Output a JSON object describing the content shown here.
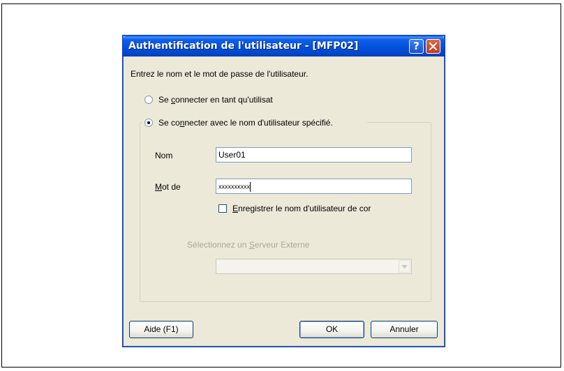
{
  "dialog": {
    "title": "Authentification de l'utilisateur - [MFP02]",
    "help_button": "?",
    "instruction": "Entrez le nom et le mot de passe de l'utilisateur."
  },
  "login_options": {
    "option_current_user_pre": "Se ",
    "option_current_user_key": "c",
    "option_current_user_post": "onnecter en tant qu'utilisat",
    "option_specified_user_pre": "Se co",
    "option_specified_user_key": "n",
    "option_specified_user_post": "necter avec le nom d'utilisateur spécifié.",
    "selected": "specified_user"
  },
  "credentials": {
    "name_label": "Nom",
    "name_value": "User01",
    "password_label_key": "M",
    "password_label_post": "ot de",
    "password_value": "xxxxxxxxxx",
    "remember_key": "E",
    "remember_post": "nregistrer le nom d'utilisateur de cor",
    "remember_checked": false
  },
  "external_server": {
    "label_pre": "Sélectionnez un ",
    "label_key": "S",
    "label_post": "erveur Externe",
    "selected_value": ""
  },
  "buttons": {
    "help": "Aide (F1)",
    "ok": "OK",
    "cancel": "Annuler"
  },
  "colors": {
    "titlebar": "#0054E3",
    "dialog_bg": "#ECE9D8",
    "disabled_text": "#A8A89A"
  }
}
